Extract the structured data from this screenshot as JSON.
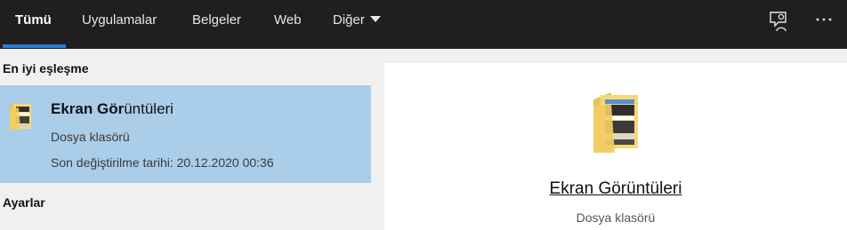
{
  "tabs": [
    {
      "label": "Tümü",
      "active": true
    },
    {
      "label": "Uygulamalar"
    },
    {
      "label": "Belgeler"
    },
    {
      "label": "Web"
    },
    {
      "label": "Diğer"
    }
  ],
  "toolbar": {
    "feedback_icon": "feedback-icon",
    "more_icon": "more-icon",
    "more_label": "···"
  },
  "best_match": {
    "section_title": "En iyi eşleşme",
    "title_match": "Ekran Gör",
    "title_rest": "üntüleri",
    "type": "Dosya klasörü",
    "modified": "Son değiştirilme tarihi: 20.12.2020 00:36"
  },
  "settings": {
    "section_title": "Ayarlar"
  },
  "preview": {
    "title": "Ekran Görüntüleri",
    "type": "Dosya klasörü"
  },
  "colors": {
    "accent": "#2a7fd4",
    "selection": "#aacde9",
    "topbar": "#1f1f1f"
  }
}
